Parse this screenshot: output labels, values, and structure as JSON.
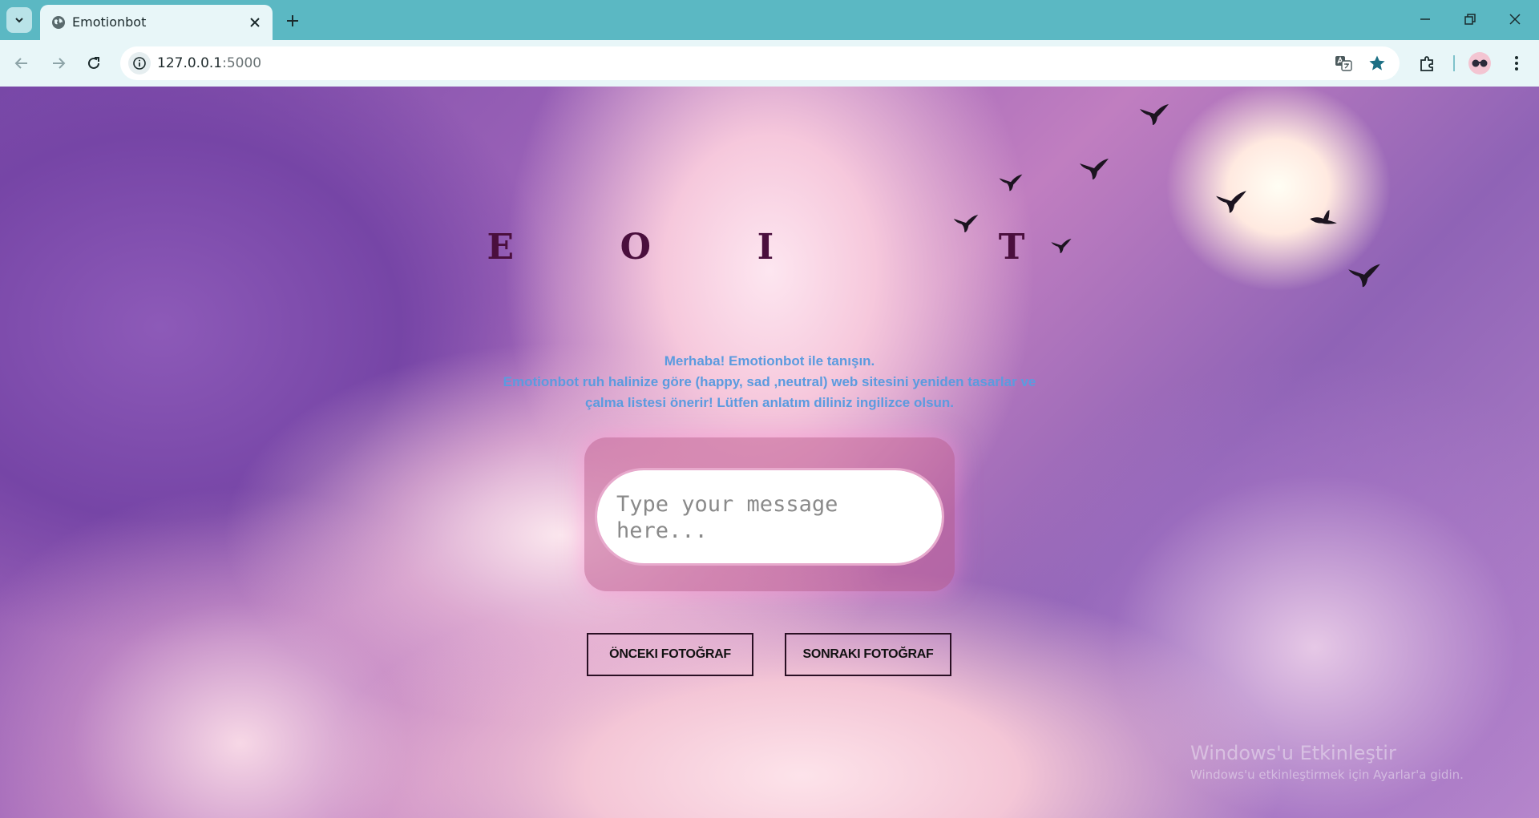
{
  "browser": {
    "tab_title": "Emotionbot",
    "url_host": "127.0.0.1",
    "url_port": ":5000"
  },
  "page": {
    "title": "E  O  I     T",
    "intro_line_1": "Merhaba! Emotionbot ile tanışın.",
    "intro_line_2": "Emotionbot ruh halinize göre (happy, sad ,neutral) web sitesini yeniden tasarlar ve",
    "intro_line_3": "çalma listesi önerir! Lütfen anlatım diliniz ingilizce olsun.",
    "message_placeholder": "Type your message here...",
    "message_value": "",
    "prev_button": "ÖNCEKI FOTOĞRAF",
    "next_button": "SONRAKI FOTOĞRAF"
  },
  "watermark": {
    "title": "Windows'u Etkinleştir",
    "subtitle": "Windows'u etkinleştirmek için Ayarlar'a gidin."
  },
  "colors": {
    "title": "#4a0f3d",
    "intro_text": "#5b9bdf",
    "chrome_accent": "#5bb8c3",
    "star_accent": "#1c6f84"
  },
  "icons": {
    "tab_search": "chevron-down-icon",
    "favicon": "globe-icon",
    "tab_close": "close-icon",
    "new_tab": "plus-icon",
    "back": "arrow-left-icon",
    "forward": "arrow-right-icon",
    "reload": "reload-icon",
    "site_info": "info-icon",
    "translate": "translate-icon",
    "bookmark": "star-icon",
    "extensions": "puzzle-icon",
    "menu": "kebab-menu-icon"
  }
}
